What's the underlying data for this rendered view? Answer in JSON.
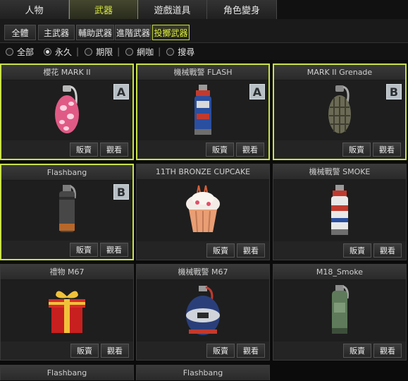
{
  "top_tabs": [
    {
      "label": "人物",
      "active": false
    },
    {
      "label": "武器",
      "active": true
    },
    {
      "label": "遊戲道具",
      "active": false
    },
    {
      "label": "角色變身",
      "active": false
    }
  ],
  "sub_tabs": [
    {
      "label": "全體",
      "active": false
    },
    {
      "label": "主武器",
      "active": false
    },
    {
      "label": "輔助武器",
      "active": false
    },
    {
      "label": "進階武器",
      "active": false
    },
    {
      "label": "投擲武器",
      "active": true
    }
  ],
  "filters": [
    {
      "label": "全部",
      "checked": false
    },
    {
      "label": "永久",
      "checked": true
    },
    {
      "label": "期限",
      "checked": false
    },
    {
      "label": "網咖",
      "checked": false
    },
    {
      "label": "搜尋",
      "checked": false
    }
  ],
  "buttons": {
    "sell": "販賣",
    "view": "觀看"
  },
  "items": [
    {
      "name": "櫻花 MARK II",
      "grade": "A",
      "selected": true,
      "icon": "sakura-grenade-icon"
    },
    {
      "name": "機械戰警 FLASH",
      "grade": "A",
      "selected": true,
      "icon": "robocop-flash-icon"
    },
    {
      "name": "MARK II Grenade",
      "grade": "B",
      "selected": true,
      "icon": "frag-grenade-icon"
    },
    {
      "name": "Flashbang",
      "grade": "B",
      "selected": true,
      "icon": "flashbang-icon"
    },
    {
      "name": "11TH BRONZE CUPCAKE",
      "grade": "",
      "selected": false,
      "icon": "cupcake-icon"
    },
    {
      "name": "機械戰警 SMOKE",
      "grade": "",
      "selected": false,
      "icon": "robocop-smoke-icon"
    },
    {
      "name": "禮物 M67",
      "grade": "",
      "selected": false,
      "icon": "gift-box-icon"
    },
    {
      "name": "機械戰警 M67",
      "grade": "",
      "selected": false,
      "icon": "robocop-m67-icon"
    },
    {
      "name": "M18_Smoke",
      "grade": "",
      "selected": false,
      "icon": "smoke-grenade-icon"
    }
  ],
  "partial_items": [
    {
      "name": "Flashbang"
    },
    {
      "name": "Flashbang"
    }
  ]
}
